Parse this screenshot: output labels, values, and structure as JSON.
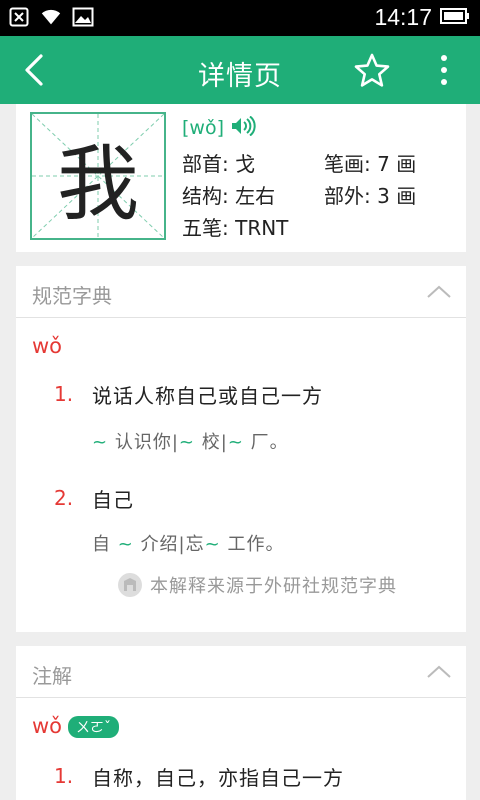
{
  "status_bar": {
    "time": "14:17",
    "icons": [
      "close-box-icon",
      "wifi-icon",
      "image-icon",
      "battery-icon"
    ]
  },
  "app_bar": {
    "title": "详情页",
    "back_icon": "back-arrow-icon",
    "favorite_icon": "star-icon",
    "more_icon": "more-vert-icon"
  },
  "character": {
    "glyph": "我",
    "pinyin": "[wǒ]",
    "radical_label": "部首:",
    "radical": "戈",
    "strokes_label": "笔画:",
    "strokes": "7 画",
    "structure_label": "结构:",
    "structure": "左右",
    "outer_label": "部外:",
    "outer": "3 画",
    "wubi_label": "五笔:",
    "wubi": "TRNT"
  },
  "dictionary": {
    "title": "规范字典",
    "pinyin": "wǒ",
    "definitions": [
      {
        "num": "1.",
        "text": "说话人称自己或自己一方",
        "example": [
          "~",
          "认识你|",
          "~",
          "校|",
          "~",
          "厂。"
        ]
      },
      {
        "num": "2.",
        "text": "自己",
        "example": [
          "自",
          "~",
          "介绍|忘",
          "~",
          "工作。"
        ]
      }
    ],
    "source": "本解释来源于外研社规范字典"
  },
  "notes": {
    "title": "注解",
    "pinyin": "wǒ",
    "zhuyin": "ㄨㄛˇ",
    "definitions": [
      {
        "num": "1.",
        "text": "自称，自己，亦指自己一方"
      }
    ]
  },
  "colors": {
    "brand": "#1fae78",
    "accent_red": "#e53935"
  }
}
